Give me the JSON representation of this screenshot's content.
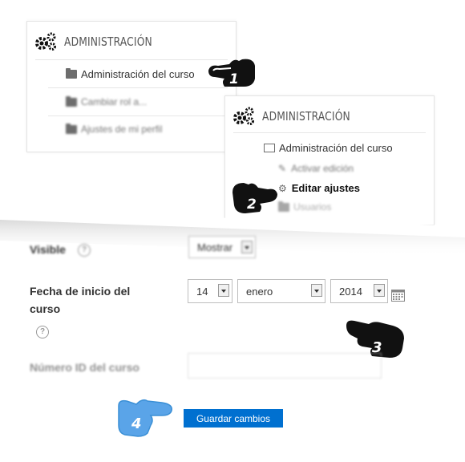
{
  "block1": {
    "title": "ADMINISTRACIÓN",
    "items": [
      {
        "label": "Administración del curso",
        "icon": "folder-icon"
      },
      {
        "label": "Cambiar rol a...",
        "icon": "folder-icon"
      },
      {
        "label": "Ajustes de mi perfil",
        "icon": "folder-icon"
      }
    ]
  },
  "block2": {
    "title": "ADMINISTRACIÓN",
    "items": [
      {
        "label": "Administración del curso",
        "icon": "folder-open-icon"
      },
      {
        "label": "Activar edición",
        "icon": "pencil-icon"
      },
      {
        "label": "Editar ajustes",
        "icon": "gear-icon"
      },
      {
        "label": "Usuarios",
        "icon": "folder-icon"
      }
    ]
  },
  "form": {
    "visible_label": "Visible",
    "visible_value": "Mostrar",
    "start_date_label": "Fecha de inicio del curso",
    "day": "14",
    "month": "enero",
    "year": "2014",
    "idnumber_label": "Número ID del curso",
    "save_button": "Guardar cambios"
  },
  "steps": [
    "1",
    "2",
    "3",
    "4"
  ],
  "colors": {
    "accent": "#0070d0",
    "hand_dark": "#111111",
    "hand_blue": "#3a8fd6"
  }
}
